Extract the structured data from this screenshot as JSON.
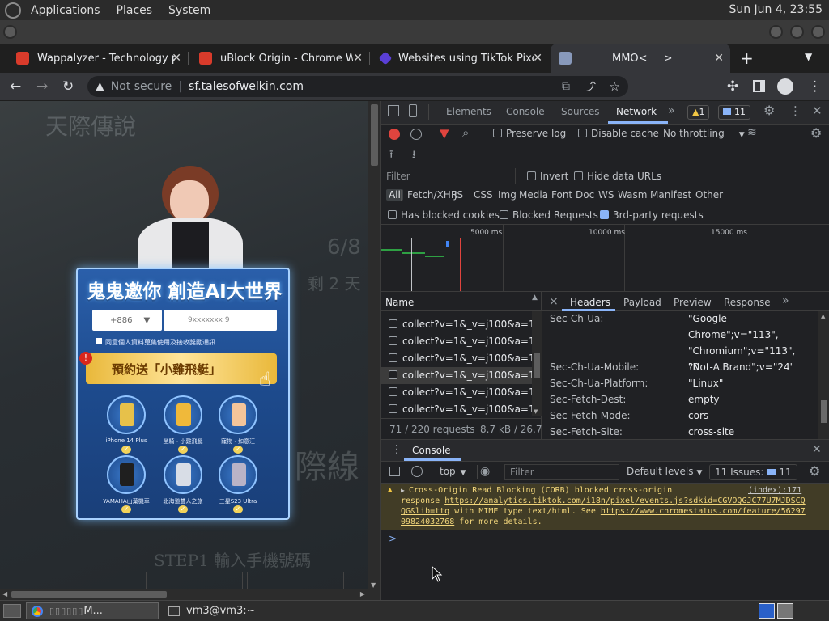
{
  "os_panel": {
    "menus": [
      "Applications",
      "Places",
      "System"
    ],
    "clock": "Sun Jun  4, 23:55"
  },
  "tabs": [
    {
      "title": "Wappalyzer - Technology pr",
      "favicon_color": "#d93b2b"
    },
    {
      "title": "uBlock Origin - Chrome We",
      "favicon_color": "#d93b2b"
    },
    {
      "title": "Websites using TikTok Pixel",
      "favicon_color": "#5a3fd6"
    },
    {
      "title": "MMO<",
      "title_suffix": ">",
      "favicon_color": "#8899bb"
    }
  ],
  "new_tab_label": "+",
  "omnibox": {
    "security": "Not secure",
    "url": "sf.talesofwelkin.com"
  },
  "page": {
    "bg_title": "天際傳說",
    "headline": "鬼鬼邀你 創造AI大世界",
    "phone_prefix": "+886",
    "phone_placeholder": "9xxxxxxx   9",
    "consent": "同意個人資料蒐集使用及接收獎勵通訊",
    "banner": "預約送「小雞飛艇」",
    "prizes": [
      "iPhone 14 Plus",
      "坐騎・小雞飛艇",
      "寵物・如意汪",
      "YAMAHA山葉機車",
      "北海道雙人之旅",
      "三星S23 Ultra"
    ],
    "step_text": "STEP1  輸入手機號碼",
    "side_date": "6/8",
    "side_remaining": "剩 2 天",
    "side_big": "際線"
  },
  "devtools": {
    "main_tabs": [
      "Elements",
      "Console",
      "Sources",
      "Network"
    ],
    "active_tab": "Network",
    "more": "»",
    "warn_count": "1",
    "msg_count": "11",
    "toolbar": {
      "preserve_log": "Preserve log",
      "disable_cache": "Disable cache",
      "throttling": "No throttling"
    },
    "filter_placeholder": "Filter",
    "invert": "Invert",
    "hide_data_urls": "Hide data URLs",
    "type_filters": [
      "All",
      "Fetch/XHR",
      "JS",
      "CSS",
      "Img",
      "Media",
      "Font",
      "Doc",
      "WS",
      "Wasm",
      "Manifest",
      "Other"
    ],
    "has_blocked_cookies": "Has blocked cookies",
    "blocked_requests": "Blocked Requests",
    "third_party": "3rd-party requests",
    "timeline_ticks": [
      "5000 ms",
      "10000 ms",
      "15000 ms"
    ],
    "name_header": "Name",
    "requests": [
      "collect?v=1&_v=j100&a=172.",
      "collect?v=1&_v=j100&a=172.",
      "collect?v=1&_v=j100&a=172.",
      "collect?v=1&_v=j100&a=172.",
      "collect?v=1&_v=j100&a=172.",
      "collect?v=1&_v=j100&a=172."
    ],
    "requests_status": "71 / 220 requests",
    "transfer_status": "8.7 kB / 26.7 k",
    "detail_tabs": [
      "Headers",
      "Payload",
      "Preview",
      "Response"
    ],
    "detail_close": "×",
    "detail_more": "»",
    "headers": [
      {
        "name": "Sec-Ch-Ua:",
        "value": "\"Google Chrome\";v=\"113\", \"Chromium\";v=\"113\", \"Not-A.Brand\";v=\"24\""
      },
      {
        "name": "Sec-Ch-Ua-Mobile:",
        "value": "?0"
      },
      {
        "name": "Sec-Ch-Ua-Platform:",
        "value": "\"Linux\""
      },
      {
        "name": "Sec-Fetch-Dest:",
        "value": "empty"
      },
      {
        "name": "Sec-Fetch-Mode:",
        "value": "cors"
      },
      {
        "name": "Sec-Fetch-Site:",
        "value": "cross-site"
      }
    ],
    "drawer": {
      "title": "Console",
      "context": "top",
      "filter_placeholder": "Filter",
      "levels": "Default levels",
      "issues_label": "11 Issues:",
      "issues_count": "11",
      "message_source": "(index):171",
      "message_line1": "Cross-Origin Read Blocking (CORB) blocked cross-origin",
      "message_line2_pre": "response ",
      "message_link1": "https://analytics.tiktok.com/i18n/pixel/events.js?sdkid=CGVOQGJC77U7MJDSCQQG&lib=ttq",
      "message_line2_mid": " with MIME type text/html. See ",
      "message_link2": "https://www.chromestatus.com/feature/5629709824032768",
      "message_tail": " for more details.",
      "prompt": ">"
    }
  },
  "taskbar": {
    "items": [
      "M...",
      "vm3@vm3:~"
    ]
  },
  "colors": {
    "accent": "#8ab4f8",
    "record": "#e0443e",
    "warn_bg": "#413c26",
    "warn_text": "#f2d67b"
  }
}
